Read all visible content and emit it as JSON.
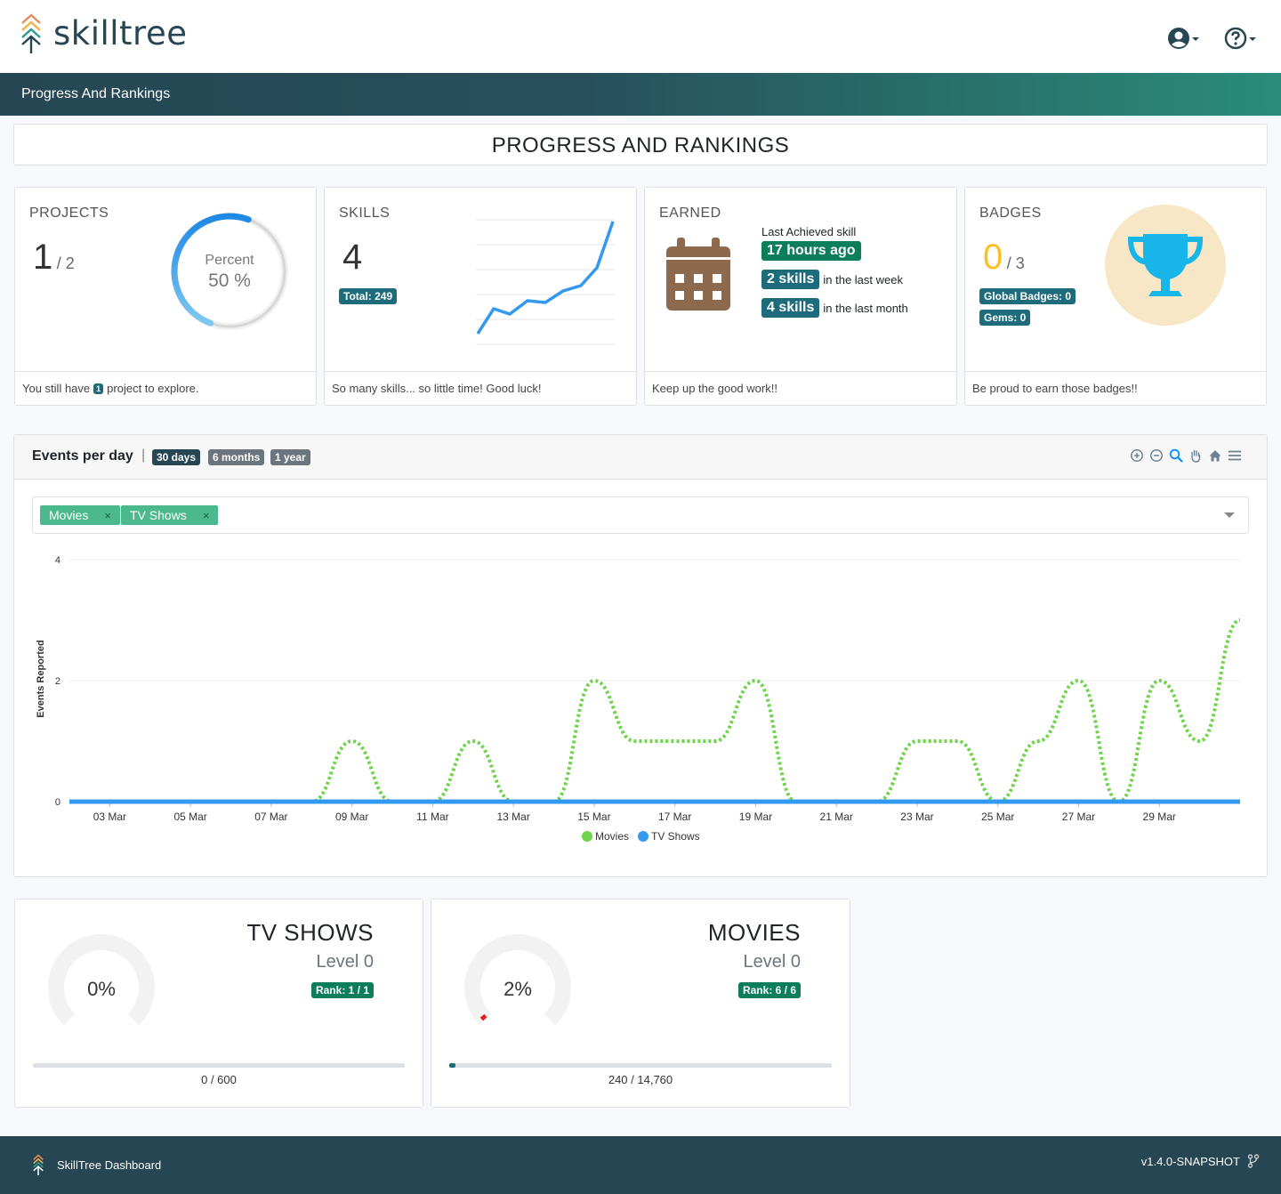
{
  "app": {
    "logo_text": "skilltree"
  },
  "header": {
    "user_menu": "user-circle-icon",
    "help_menu": "question-circle-icon"
  },
  "banner": {
    "title": "Progress And Rankings"
  },
  "page_title": "PROGRESS AND RANKINGS",
  "cards": {
    "projects": {
      "title": "PROJECTS",
      "value": "1",
      "of": "/ 2",
      "percent_label": "Percent",
      "percent_value": "50 %",
      "percent": 50,
      "footer_pre": "You still have",
      "footer_badge": "1",
      "footer_post": "project to explore."
    },
    "skills": {
      "title": "SKILLS",
      "value": "4",
      "total_badge": "Total: 249",
      "footer": "So many skills... so little time! Good luck!"
    },
    "earned": {
      "title": "EARNED",
      "last_label": "Last Achieved skill",
      "last_value": "17 hours ago",
      "week_badge": "2 skills",
      "week_text": "in the last week",
      "month_badge": "4 skills",
      "month_text": "in the last month",
      "footer": "Keep up the good work!!"
    },
    "badges": {
      "title": "BADGES",
      "value": "0",
      "of": "/ 3",
      "global_badge": "Global Badges: 0",
      "gems_badge": "Gems: 0",
      "footer": "Be proud to earn those badges!!"
    }
  },
  "events": {
    "title": "Events per day",
    "separator": "|",
    "ranges": [
      "30 days",
      "6 months",
      "1 year"
    ],
    "tags": [
      "Movies",
      "TV Shows"
    ],
    "tag_close": "×"
  },
  "chart_data": {
    "type": "line",
    "ylabel": "Events Reported",
    "ylim": [
      0,
      4
    ],
    "yticks": [
      "0",
      "2",
      "4"
    ],
    "x_labels": [
      "03 Mar",
      "05 Mar",
      "07 Mar",
      "09 Mar",
      "11 Mar",
      "13 Mar",
      "15 Mar",
      "17 Mar",
      "19 Mar",
      "21 Mar",
      "23 Mar",
      "25 Mar",
      "27 Mar",
      "29 Mar"
    ],
    "x": [
      "02 Mar",
      "03 Mar",
      "04 Mar",
      "05 Mar",
      "06 Mar",
      "07 Mar",
      "08 Mar",
      "09 Mar",
      "10 Mar",
      "11 Mar",
      "12 Mar",
      "13 Mar",
      "14 Mar",
      "15 Mar",
      "16 Mar",
      "17 Mar",
      "18 Mar",
      "19 Mar",
      "20 Mar",
      "21 Mar",
      "22 Mar",
      "23 Mar",
      "24 Mar",
      "25 Mar",
      "26 Mar",
      "27 Mar",
      "28 Mar",
      "29 Mar",
      "30 Mar",
      "31 Mar"
    ],
    "series": [
      {
        "name": "Movies",
        "color": "#6ed44a",
        "values": [
          0,
          0,
          0,
          0,
          0,
          0,
          0,
          1,
          0,
          0,
          1,
          0,
          0,
          2,
          1,
          1,
          1,
          2,
          0,
          0,
          0,
          1,
          1,
          0,
          1,
          2,
          0,
          2,
          1,
          3
        ]
      },
      {
        "name": "TV Shows",
        "color": "#3399ee",
        "values": [
          0,
          0,
          0,
          0,
          0,
          0,
          0,
          0,
          0,
          0,
          0,
          0,
          0,
          0,
          0,
          0,
          0,
          0,
          0,
          0,
          0,
          0,
          0,
          0,
          0,
          0,
          0,
          0,
          0,
          0
        ]
      }
    ],
    "legend_position": "bottom"
  },
  "subjects": [
    {
      "name": "TV SHOWS",
      "level": "Level 0",
      "rank": "Rank: 1 / 1",
      "percent_label": "0%",
      "percent": 0,
      "points": "0 / 600",
      "progress": 0
    },
    {
      "name": "MOVIES",
      "level": "Level 0",
      "rank": "Rank: 6 / 6",
      "percent_label": "2%",
      "percent": 2,
      "points": "240 / 14,760",
      "progress": 1.6
    }
  ],
  "footer": {
    "left_text": "SkillTree Dashboard",
    "version": "v1.4.0-SNAPSHOT"
  },
  "colors": {
    "primary": "#264653",
    "accent_teal": "#1e6b7b",
    "accent_green": "#0c7e5a",
    "badge_gold": "#fbbf25",
    "trophy_blue": "#18b5e8",
    "calendar_brown": "#8d6a4e",
    "skill_line": "#3399ee"
  }
}
